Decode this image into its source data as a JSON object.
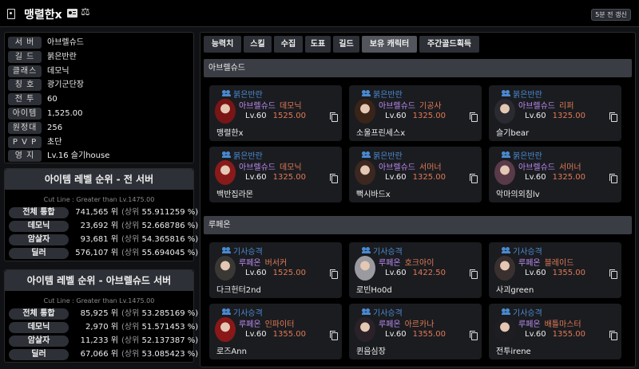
{
  "header": {
    "name": "맹렬한x",
    "scale_icon": "⚖",
    "refresh_label": "5분 전 갱신"
  },
  "profile": [
    {
      "label": "서 버",
      "value": "아브렐슈드"
    },
    {
      "label": "길 드",
      "value": "붉은반란"
    },
    {
      "label": "클래스",
      "value": "데모닉"
    },
    {
      "label": "칭 호",
      "value": "광기군단장"
    },
    {
      "label": "전 투",
      "value": "60"
    },
    {
      "label": "아이템",
      "value": "1,525.00"
    },
    {
      "label": "원정대",
      "value": "256"
    },
    {
      "label": "P V P",
      "value": "초단"
    },
    {
      "label": "영 지",
      "value": "Lv.16 슬기house"
    }
  ],
  "rank_all": {
    "title": "아이템 레벨 순위 - 전 서버",
    "cutline": "Cut Line : Greater than Lv.1475.00",
    "rows": [
      {
        "label": "전체 통합",
        "rank": "741,565 위",
        "pct": "55.911259 %"
      },
      {
        "label": "데모닉",
        "rank": "23,692 위",
        "pct": "52.668786 %"
      },
      {
        "label": "암살자",
        "rank": "93,681 위",
        "pct": "54.365816 %"
      },
      {
        "label": "딜러",
        "rank": "576,107 위",
        "pct": "55.694045 %"
      }
    ]
  },
  "rank_server": {
    "title": "아이템 레벨 순위 - 아브렐슈드 서버",
    "cutline": "Cut Line : Greater than Lv.1475.00",
    "rows": [
      {
        "label": "전체 통합",
        "rank": "85,925 위",
        "pct": "53.285169 %"
      },
      {
        "label": "데모닉",
        "rank": "2,970 위",
        "pct": "51.571453 %"
      },
      {
        "label": "암살자",
        "rank": "11,233 위",
        "pct": "52.137387 %"
      },
      {
        "label": "딜러",
        "rank": "67,066 위",
        "pct": "53.085423 %"
      }
    ]
  },
  "rank_prefix": "(상위",
  "rank_suffix": ")",
  "tabs": [
    "능력치",
    "스킬",
    "수집",
    "도표",
    "길드",
    "보유 캐릭터",
    "주간골드획득"
  ],
  "active_tab": 5,
  "sections": [
    {
      "title": "아브렐슈드",
      "cards": [
        {
          "guild": "붉은반란",
          "server": "아브렐슈드",
          "class": "데모닉",
          "lv": "Lv.60",
          "ilvl": "1525.00",
          "name": "맹렬한x",
          "hair": "#7a1515"
        },
        {
          "guild": "붉은반란",
          "server": "아브렐슈드",
          "class": "기공사",
          "lv": "Lv.60",
          "ilvl": "1325.00",
          "name": "소울프린세스x",
          "hair": "#3a2418"
        },
        {
          "guild": "붉은반란",
          "server": "아브렐슈드",
          "class": "리퍼",
          "lv": "Lv.60",
          "ilvl": "1325.00",
          "name": "슬기bear",
          "hair": "#2a2a30"
        },
        {
          "guild": "붉은반란",
          "server": "아브렐슈드",
          "class": "데모닉",
          "lv": "Lv.60",
          "ilvl": "1325.00",
          "name": "백반집라몬",
          "hair": "#8a1a1a"
        },
        {
          "guild": "붉은반란",
          "server": "아브렐슈드",
          "class": "서머너",
          "lv": "Lv.60",
          "ilvl": "1325.00",
          "name": "뻑시바드x",
          "hair": "#3c2820"
        },
        {
          "guild": "붉은반란",
          "server": "아브렐슈드",
          "class": "서머너",
          "lv": "Lv.60",
          "ilvl": "1325.00",
          "name": "악마의외침lv",
          "hair": "#5a3a48"
        }
      ]
    },
    {
      "title": "루페온",
      "cards": [
        {
          "guild": "기사승격",
          "server": "루페온",
          "class": "버서커",
          "lv": "Lv.60",
          "ilvl": "1525.00",
          "name": "다크헌터2nd",
          "hair": "#3a3835"
        },
        {
          "guild": "기사승격",
          "server": "루페온",
          "class": "호크아이",
          "lv": "Lv.60",
          "ilvl": "1422.50",
          "name": "로빈Ho0d",
          "hair": "#9a9aa0"
        },
        {
          "guild": "기사승격",
          "server": "루페온",
          "class": "블레이드",
          "lv": "Lv.60",
          "ilvl": "1355.00",
          "name": "사괴green",
          "hair": "#3a3030"
        },
        {
          "guild": "기사승격",
          "server": "루페온",
          "class": "인파이터",
          "lv": "Lv.60",
          "ilvl": "1355.00",
          "name": "로즈Ann",
          "hair": "#8a1818"
        },
        {
          "guild": "기사승격",
          "server": "루페온",
          "class": "아르카나",
          "lv": "Lv.60",
          "ilvl": "1355.00",
          "name": "퀸음심장",
          "hair": "#2a2228"
        },
        {
          "guild": "기사승격",
          "server": "루페온",
          "class": "배틀마스터",
          "lv": "Lv.60",
          "ilvl": "1355.00",
          "name": "전투irene",
          "hair": "#1e1e22"
        }
      ]
    }
  ]
}
